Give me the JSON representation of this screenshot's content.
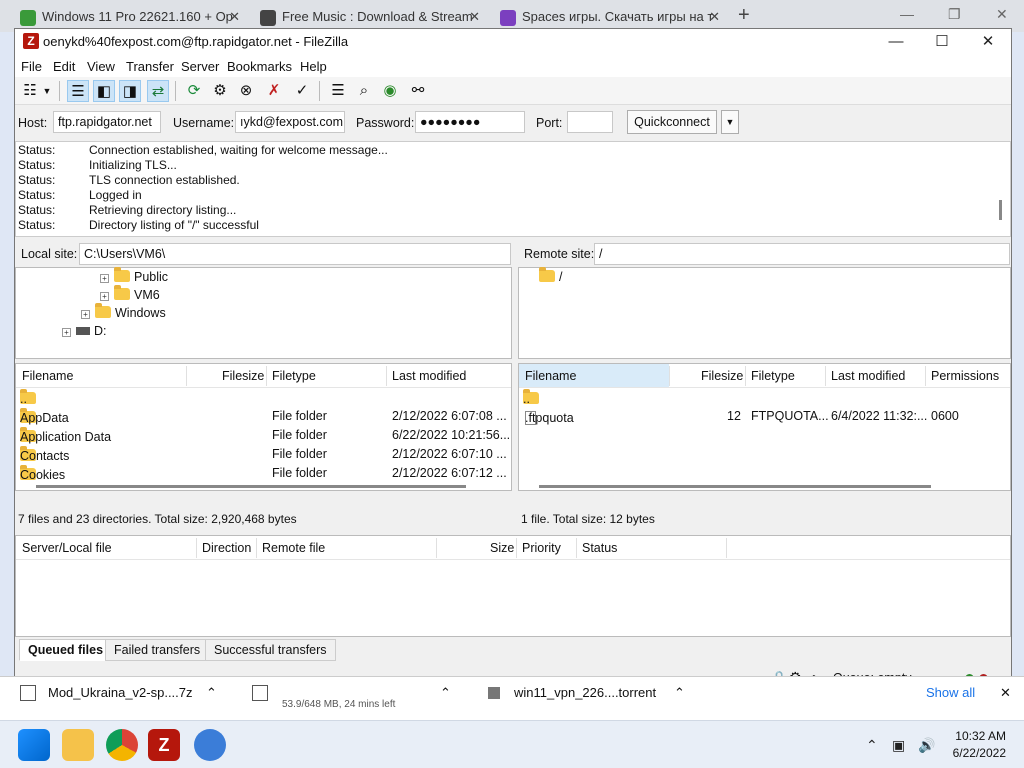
{
  "browser_tabs": [
    {
      "title": "Windows 11 Pro 22621.160 + Op",
      "color": "#3a9a3a"
    },
    {
      "title": "Free Music : Download & Stream",
      "color": "#444444"
    },
    {
      "title": "Spaces игры. Скачать игры на т",
      "color": "#7b3fbf"
    }
  ],
  "window": {
    "title": "oenykd%40fexpost.com@ftp.rapidgator.net - FileZilla"
  },
  "menu": [
    "File",
    "Edit",
    "View",
    "Transfer",
    "Server",
    "Bookmarks",
    "Help"
  ],
  "quickconnect": {
    "host_label": "Host:",
    "host": "ftp.rapidgator.net",
    "user_label": "Username:",
    "user": "ıykd@fexpost.com",
    "pass_label": "Password:",
    "pass": "●●●●●●●●",
    "port_label": "Port:",
    "port": "",
    "button": "Quickconnect"
  },
  "log": [
    {
      "k": "Status:",
      "v": "Connection established, waiting for welcome message..."
    },
    {
      "k": "Status:",
      "v": "Initializing TLS..."
    },
    {
      "k": "Status:",
      "v": "TLS connection established."
    },
    {
      "k": "Status:",
      "v": "Logged in"
    },
    {
      "k": "Status:",
      "v": "Retrieving directory listing..."
    },
    {
      "k": "Status:",
      "v": "Directory listing of \"/\" successful"
    }
  ],
  "local": {
    "label": "Local site:",
    "path": "C:\\Users\\VM6\\",
    "tree": [
      "Public",
      "VM6",
      "Windows",
      "D:"
    ],
    "headers": [
      "Filename",
      "Filesize",
      "Filetype",
      "Last modified"
    ],
    "rows": [
      {
        "name": "..",
        "size": "",
        "type": "",
        "mod": ""
      },
      {
        "name": "AppData",
        "size": "",
        "type": "File folder",
        "mod": "2/12/2022 6:07:08 ..."
      },
      {
        "name": "Application Data",
        "size": "",
        "type": "File folder",
        "mod": "6/22/2022 10:21:56..."
      },
      {
        "name": "Contacts",
        "size": "",
        "type": "File folder",
        "mod": "2/12/2022 6:07:10 ..."
      },
      {
        "name": "Cookies",
        "size": "",
        "type": "File folder",
        "mod": "2/12/2022 6:07:12 ..."
      }
    ],
    "status": "7 files and 23 directories. Total size: 2,920,468 bytes"
  },
  "remote": {
    "label": "Remote site:",
    "path": "/",
    "tree": [
      "/"
    ],
    "headers": [
      "Filename",
      "Filesize",
      "Filetype",
      "Last modified",
      "Permissions"
    ],
    "rows": [
      {
        "name": "..",
        "size": "",
        "type": "",
        "mod": "",
        "perm": ""
      },
      {
        "name": ".ftpquota",
        "size": "12",
        "type": "FTPQUOTA...",
        "mod": "6/4/2022 11:32:...",
        "perm": "0600"
      }
    ],
    "status": "1 file. Total size: 12 bytes"
  },
  "queue": {
    "headers": [
      "Server/Local file",
      "Direction",
      "Remote file",
      "Size",
      "Priority",
      "Status"
    ],
    "tabs": [
      "Queued files",
      "Failed transfers",
      "Successful transfers"
    ],
    "status": "Queue: empty"
  },
  "downloads": [
    {
      "name": "Mod_Ukraina_v2-sp....7z"
    },
    {
      "name": "53.9/648 MB, 24 mins left"
    },
    {
      "name": "win11_vpn_226....torrent"
    }
  ],
  "downloads_showall": "Show all",
  "clock": {
    "time": "10:32 AM",
    "date": "6/22/2022"
  }
}
